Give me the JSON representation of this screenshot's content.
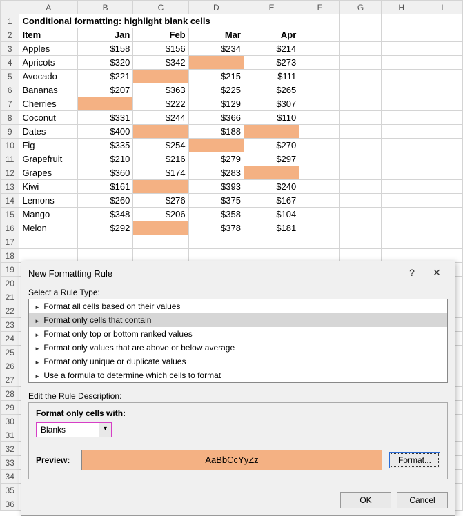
{
  "columns": [
    "A",
    "B",
    "C",
    "D",
    "E",
    "F",
    "G",
    "H",
    "I"
  ],
  "row_count": 36,
  "title": "Conditional formatting: highlight blank cells",
  "headers": {
    "item": "Item",
    "jan": "Jan",
    "feb": "Feb",
    "mar": "Mar",
    "apr": "Apr"
  },
  "rows": [
    {
      "item": "Apples",
      "jan": "$158",
      "feb": "$156",
      "mar": "$234",
      "apr": "$214"
    },
    {
      "item": "Apricots",
      "jan": "$320",
      "feb": "$342",
      "mar": "",
      "apr": "$273"
    },
    {
      "item": "Avocado",
      "jan": "$221",
      "feb": "",
      "mar": "$215",
      "apr": "$111"
    },
    {
      "item": "Bananas",
      "jan": "$207",
      "feb": "$363",
      "mar": "$225",
      "apr": "$265"
    },
    {
      "item": "Cherries",
      "jan": "",
      "feb": "$222",
      "mar": "$129",
      "apr": "$307"
    },
    {
      "item": "Coconut",
      "jan": "$331",
      "feb": "$244",
      "mar": "$366",
      "apr": "$110"
    },
    {
      "item": "Dates",
      "jan": "$400",
      "feb": "",
      "mar": "$188",
      "apr": ""
    },
    {
      "item": "Fig",
      "jan": "$335",
      "feb": "$254",
      "mar": "",
      "apr": "$270"
    },
    {
      "item": "Grapefruit",
      "jan": "$210",
      "feb": "$216",
      "mar": "$279",
      "apr": "$297"
    },
    {
      "item": "Grapes",
      "jan": "$360",
      "feb": "$174",
      "mar": "$283",
      "apr": ""
    },
    {
      "item": "Kiwi",
      "jan": "$161",
      "feb": "",
      "mar": "$393",
      "apr": "$240"
    },
    {
      "item": "Lemons",
      "jan": "$260",
      "feb": "$276",
      "mar": "$375",
      "apr": "$167"
    },
    {
      "item": "Mango",
      "jan": "$348",
      "feb": "$206",
      "mar": "$358",
      "apr": "$104"
    },
    {
      "item": "Melon",
      "jan": "$292",
      "feb": "",
      "mar": "$378",
      "apr": "$181"
    }
  ],
  "dialog": {
    "title": "New Formatting Rule",
    "help": "?",
    "close": "✕",
    "select_label": "Select a Rule Type:",
    "rule_types": [
      "Format all cells based on their values",
      "Format only cells that contain",
      "Format only top or bottom ranked values",
      "Format only values that are above or below average",
      "Format only unique or duplicate values",
      "Use a formula to determine which cells to format"
    ],
    "selected_index": 1,
    "edit_label": "Edit the Rule Description:",
    "cells_with_label": "Format only cells with:",
    "cells_with_value": "Blanks",
    "preview_label": "Preview:",
    "preview_sample": "AaBbCcYyZz",
    "format_btn": "Format...",
    "ok": "OK",
    "cancel": "Cancel"
  }
}
